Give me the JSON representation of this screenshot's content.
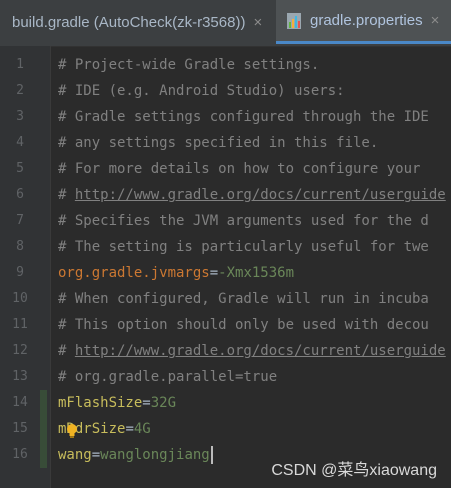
{
  "tabs": [
    {
      "label": "build.gradle (AutoCheck(zk-r3568))",
      "close": "×",
      "active": false,
      "icon": "gradle-file-icon"
    },
    {
      "label": "gradle.properties",
      "close": "×",
      "active": true,
      "icon": "properties-file-icon"
    }
  ],
  "lines": [
    {
      "n": "1",
      "text": "# Project-wide Gradle settings."
    },
    {
      "n": "2",
      "text": "# IDE (e.g. Android Studio) users:"
    },
    {
      "n": "3",
      "text": "# Gradle settings configured through the IDE"
    },
    {
      "n": "4",
      "text": "# any settings specified in this file."
    },
    {
      "n": "5",
      "text": "# For more details on how to configure your"
    },
    {
      "n": "6",
      "prefix": "# ",
      "link": "http://www.gradle.org/docs/current/userguide"
    },
    {
      "n": "7",
      "text": "# Specifies the JVM arguments used for the d"
    },
    {
      "n": "8",
      "text": "# The setting is particularly useful for twe"
    },
    {
      "n": "9",
      "key": "org.gradle.jvmargs",
      "eq": "=",
      "value": "-Xmx1536m"
    },
    {
      "n": "10",
      "text": "# When configured, Gradle will run in incuba"
    },
    {
      "n": "11",
      "text": "# This option should only be used with decou"
    },
    {
      "n": "12",
      "prefix": "# ",
      "link": "http://www.gradle.org/docs/current/userguide"
    },
    {
      "n": "13",
      "text": "# org.gradle.parallel=true"
    },
    {
      "n": "14",
      "key": "mFlashSize",
      "eq": "=",
      "value": "32G"
    },
    {
      "n": "15",
      "key": "mDdrSize",
      "eq": "=",
      "value": "4G"
    },
    {
      "n": "16",
      "key": "wang",
      "eq": "=",
      "value": "wanglongjiang"
    }
  ],
  "watermark": "CSDN @菜鸟xiaowang",
  "colors": {
    "background": "#2b2b2b",
    "comment": "#808080",
    "key": "#cc7832",
    "value": "#6a8759",
    "active_tab_underline": "#4a88c7"
  }
}
